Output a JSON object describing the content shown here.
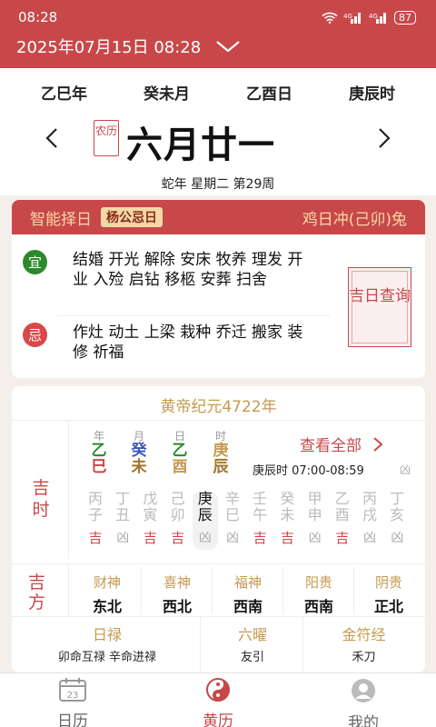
{
  "status_bar": {
    "time": "08:28",
    "signal": "◆◆",
    "battery": "87"
  },
  "header": {
    "datetime": "2025年07月15日 08:28"
  },
  "ganzhi": [
    "乙巳年",
    "癸未月",
    "乙酉日",
    "庚辰时"
  ],
  "lunar": {
    "stamp": "农历",
    "day": "六月廿一"
  },
  "subline": "蛇年 星期二 第29周",
  "almanac": {
    "tab": "智能择日",
    "tag": "杨公忌日",
    "chong": "鸡日冲(己卯)兔",
    "yi_label": "宜",
    "yi": "结婚 开光 解除 安床 牧养 理发 开业 入殓 启钻 移柩 安葬 扫舍",
    "ji_label": "忌",
    "ji": "作灶 动土 上梁 栽种 乔迁 搬家 装修 祈福",
    "jiri": "吉日查询"
  },
  "huangdi": "黄帝纪元4722年",
  "jishi_label": "吉时",
  "pillars": [
    {
      "title": "年",
      "top": "乙",
      "bottom": "巳",
      "tc": "#2a8a2a",
      "bc": "#c8484a"
    },
    {
      "title": "月",
      "top": "癸",
      "bottom": "未",
      "tc": "#3a56b8",
      "bc": "#a0772a"
    },
    {
      "title": "日",
      "top": "乙",
      "bottom": "酉",
      "tc": "#2a8a2a",
      "bc": "#c59a4f"
    },
    {
      "title": "时",
      "top": "庚",
      "bottom": "辰",
      "tc": "#c59a4f",
      "bc": "#a0772a"
    }
  ],
  "view_all": "查看全部",
  "shichen_line": "庚辰时 07:00-08:59",
  "shichen_jx": "凶",
  "hours": [
    {
      "g": "丙",
      "z": "子",
      "jx": "吉"
    },
    {
      "g": "丁",
      "z": "丑",
      "jx": "凶"
    },
    {
      "g": "戊",
      "z": "寅",
      "jx": "吉"
    },
    {
      "g": "己",
      "z": "卯",
      "jx": "吉"
    },
    {
      "g": "庚",
      "z": "辰",
      "jx": "凶",
      "current": true
    },
    {
      "g": "辛",
      "z": "巳",
      "jx": "凶"
    },
    {
      "g": "壬",
      "z": "午",
      "jx": "吉"
    },
    {
      "g": "癸",
      "z": "未",
      "jx": "吉"
    },
    {
      "g": "甲",
      "z": "申",
      "jx": "凶"
    },
    {
      "g": "乙",
      "z": "酉",
      "jx": "吉"
    },
    {
      "g": "丙",
      "z": "戌",
      "jx": "凶"
    },
    {
      "g": "丁",
      "z": "亥",
      "jx": "凶"
    }
  ],
  "jifang_label": "吉方",
  "gods": [
    {
      "name": "财神",
      "dir": "东北"
    },
    {
      "name": "喜神",
      "dir": "西北"
    },
    {
      "name": "福神",
      "dir": "西南"
    },
    {
      "name": "阳贵",
      "dir": "西南"
    },
    {
      "name": "阴贵",
      "dir": "正北"
    }
  ],
  "bottom": [
    {
      "name": "日禄",
      "desc": "卯命互禄 辛命进禄"
    },
    {
      "name": "六曜",
      "desc": "友引"
    },
    {
      "name": "金符经",
      "desc": "禾刀"
    }
  ],
  "tabs": [
    {
      "label": "日历",
      "icon_text": "23"
    },
    {
      "label": "黄历"
    },
    {
      "label": "我的"
    }
  ],
  "colors": {
    "accent": "#c8484a",
    "gold": "#c59a4f",
    "good": "#c8484a",
    "bad": "#aaaaaa",
    "yi": "#2a8a2a",
    "ji": "#d9484a"
  }
}
